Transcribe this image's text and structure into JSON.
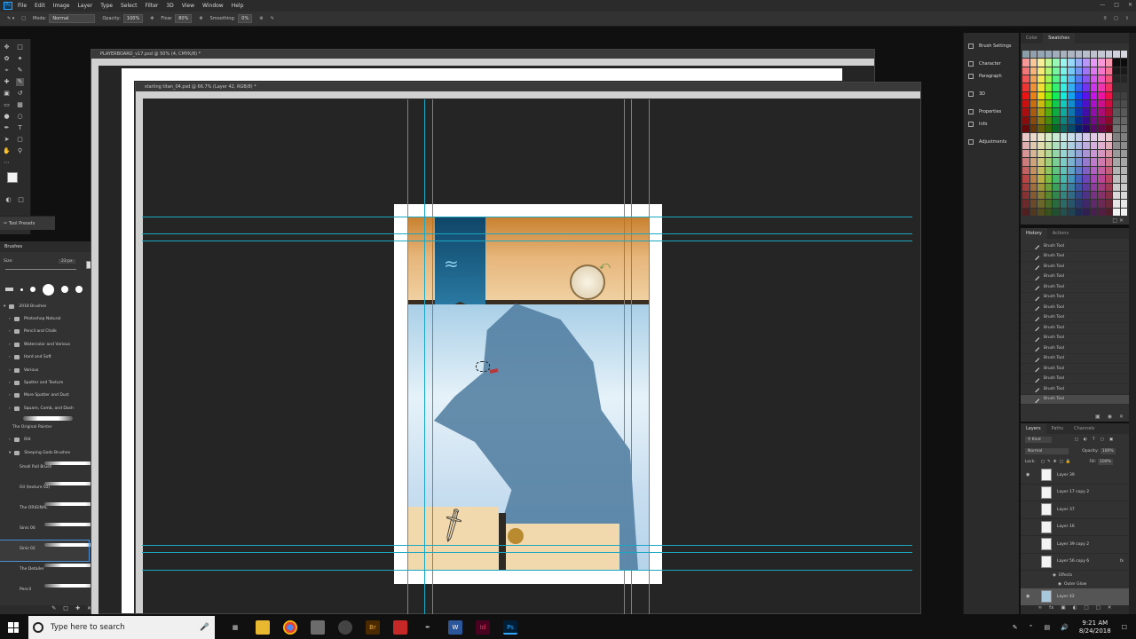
{
  "menubar": {
    "logo": "Ps",
    "items": [
      "File",
      "Edit",
      "Image",
      "Layer",
      "Type",
      "Select",
      "Filter",
      "3D",
      "View",
      "Window",
      "Help"
    ]
  },
  "options": {
    "mode_label": "Mode:",
    "mode_value": "Normal",
    "opacity_label": "Opacity:",
    "opacity_value": "100%",
    "flow_label": "Flow:",
    "flow_value": "80%",
    "smoothing_label": "Smoothing:",
    "smoothing_value": "0%"
  },
  "doc_back": {
    "title": "PLAYERBOARD_v17.psd @ 50% (4, CMYK/8) *"
  },
  "doc_front": {
    "title": "starling titan_04.psd @ 66.7% (Layer 42, RGB/8) *"
  },
  "tool_presets": {
    "label": "Tool Presets"
  },
  "brushes": {
    "title": "Brushes",
    "size_label": "Size:",
    "size_value": "23 px",
    "root": "2018 Brushes",
    "folders": [
      "Photoshop Natural",
      "Pencil and Chalk",
      "Watercolor and Various",
      "Hard and Soft",
      "Various",
      "Spatter and Texture",
      "More Spatter and Dust",
      "Square, Comb, and Dash"
    ],
    "painter": "The Original Painter",
    "group_old": "Old",
    "group_gods": "Sleeping Gods Brushes",
    "items": [
      "Small Pull Brush",
      "Oil (texture 02)",
      "The ORIGINAL",
      "Sinis 06",
      "Sinis 02",
      "The Detailer",
      "Pencil"
    ]
  },
  "side_icons": [
    "Brush Settings",
    "Character",
    "Paragraph",
    "3D",
    "Properties",
    "Info",
    "Adjustments"
  ],
  "swatches": {
    "tabs": [
      "Color",
      "Swatches"
    ]
  },
  "history": {
    "tabs": [
      "History",
      "Actions"
    ],
    "rows": [
      "Brush Tool",
      "Brush Tool",
      "Brush Tool",
      "Brush Tool",
      "Brush Tool",
      "Brush Tool",
      "Brush Tool",
      "Brush Tool",
      "Brush Tool",
      "Brush Tool",
      "Brush Tool",
      "Brush Tool",
      "Brush Tool",
      "Brush Tool",
      "Brush Tool",
      "Brush Tool"
    ]
  },
  "layers": {
    "tabs": [
      "Layers",
      "Paths",
      "Channels"
    ],
    "kind": "Kind",
    "blend": "Normal",
    "opacity_label": "Opacity:",
    "opacity_value": "100%",
    "lock_label": "Lock:",
    "fill_label": "Fill:",
    "fill_value": "100%",
    "rows": [
      "Layer 39",
      "Layer 17 copy 2",
      "Layer 37",
      "Layer 16",
      "Layer 39 copy 2",
      "Layer 56 copy 6"
    ],
    "effects": "Effects",
    "outer_glow": "Outer Glow",
    "active": "Layer 42",
    "fx": "fx"
  },
  "taskbar": {
    "search_placeholder": "Type here to search",
    "time": "9:21 AM",
    "date": "8/24/2018",
    "apps": [
      "Br",
      "Id",
      "Ps",
      "W"
    ]
  },
  "colors": {
    "accent": "#31a8ff",
    "guide": "#1ba7c2",
    "sky": "#c3dff0",
    "wolf": "#4d7a9e",
    "parchment": "#e8b98c",
    "banner": "#1f6189"
  }
}
